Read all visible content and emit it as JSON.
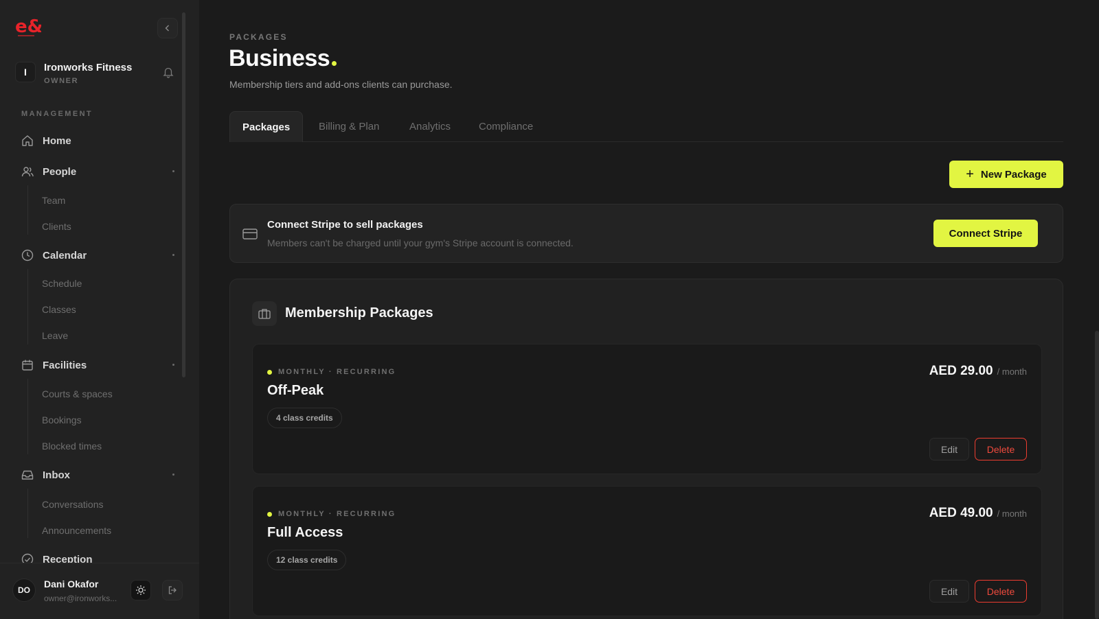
{
  "sidebar": {
    "logo_text": "e&",
    "org": {
      "initial": "I",
      "name": "Ironworks Fitness",
      "role": "OWNER"
    },
    "section_label": "MANAGEMENT",
    "nav": {
      "home": "Home",
      "people": "People",
      "people_sub": [
        "Team",
        "Clients"
      ],
      "calendar": "Calendar",
      "calendar_sub": [
        "Schedule",
        "Classes",
        "Leave"
      ],
      "facilities": "Facilities",
      "facilities_sub": [
        "Courts & spaces",
        "Bookings",
        "Blocked times"
      ],
      "inbox": "Inbox",
      "inbox_sub": [
        "Conversations",
        "Announcements"
      ],
      "reception": "Reception"
    },
    "user": {
      "initials": "DO",
      "name": "Dani Okafor",
      "email": "owner@ironworks..."
    }
  },
  "header": {
    "eyebrow": "PACKAGES",
    "title": "Business",
    "subtitle": "Membership tiers and add-ons clients can purchase."
  },
  "tabs": [
    "Packages",
    "Billing & Plan",
    "Analytics",
    "Compliance"
  ],
  "actions": {
    "new_package": "New Package"
  },
  "stripe": {
    "title": "Connect Stripe to sell packages",
    "description": "Members can't be charged until your gym's Stripe account is connected.",
    "button": "Connect Stripe"
  },
  "packages_panel": {
    "title": "Membership Packages",
    "items": [
      {
        "meta": "MONTHLY · RECURRING",
        "name": "Off-Peak",
        "credits": "4 class credits",
        "price": "AED 29.00",
        "period": "/ month",
        "edit": "Edit",
        "delete": "Delete"
      },
      {
        "meta": "MONTHLY · RECURRING",
        "name": "Full Access",
        "credits": "12 class credits",
        "price": "AED 49.00",
        "period": "/ month",
        "edit": "Edit",
        "delete": "Delete"
      }
    ]
  },
  "colors": {
    "accent": "#e2f542",
    "danger": "#ee3d30",
    "brand_logo": "#e8232a",
    "bg": "#1b1b1b",
    "sidebar": "#222222"
  }
}
